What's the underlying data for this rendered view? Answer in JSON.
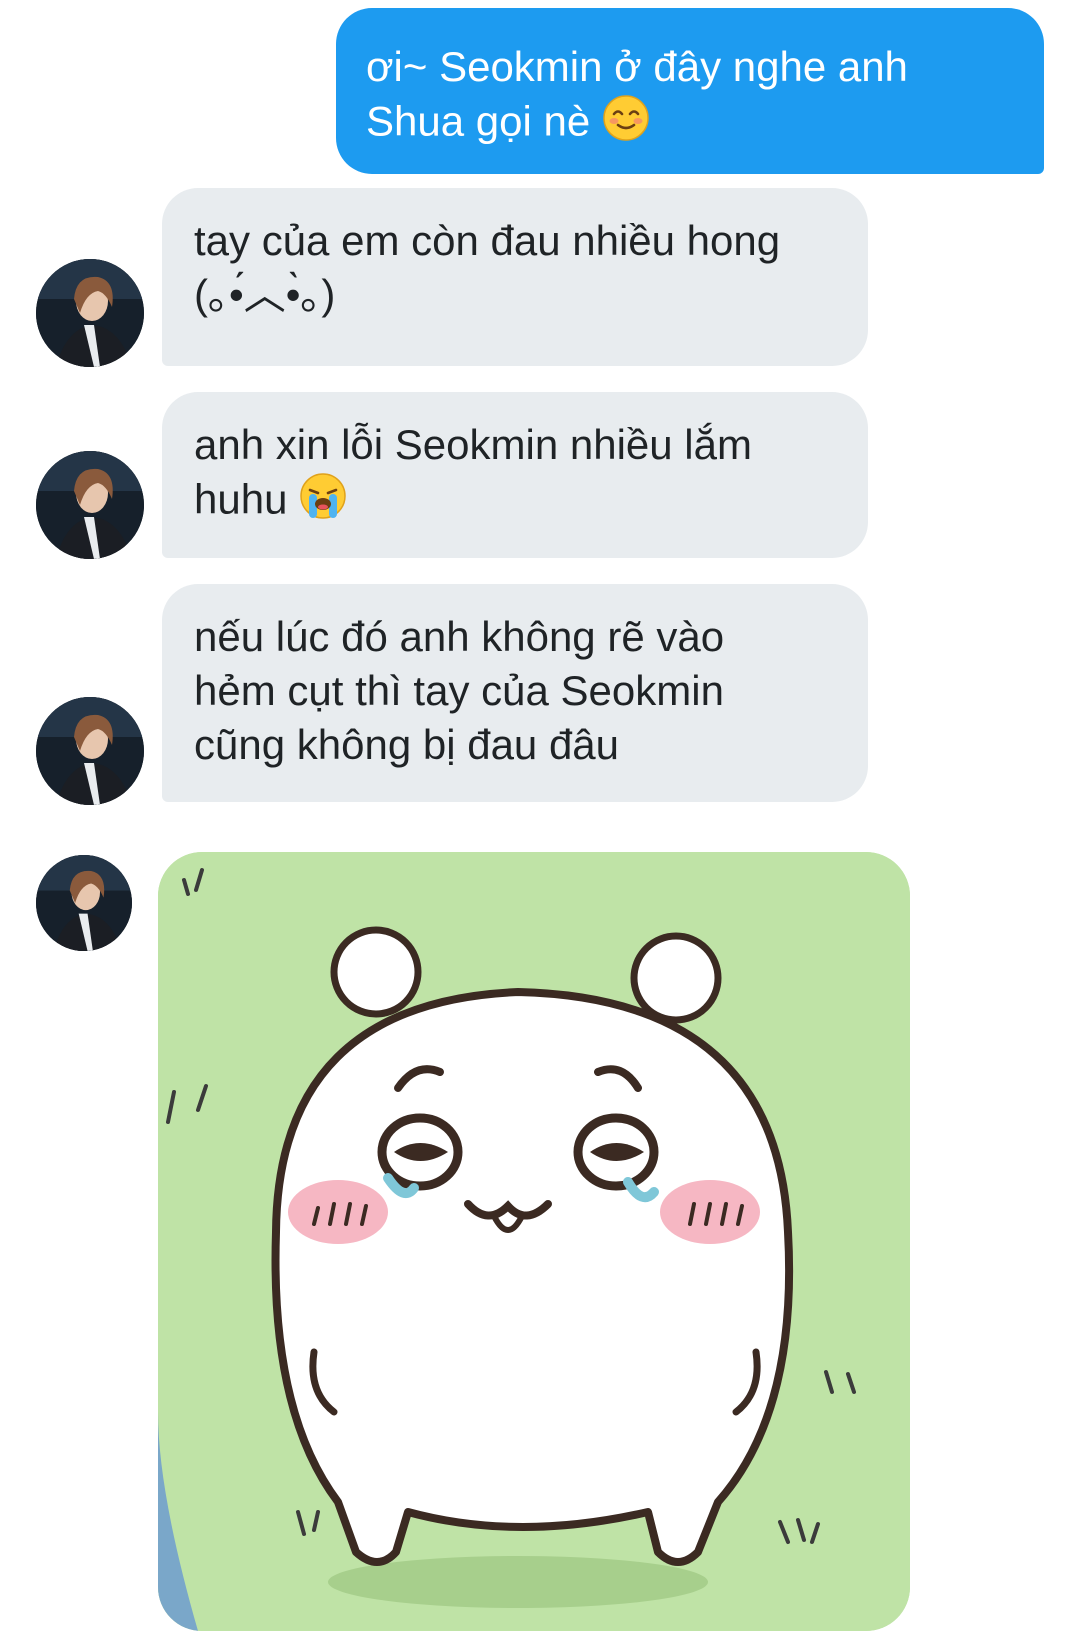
{
  "conversation": {
    "sent_messages": [
      {
        "line1": "ơi~ Seokmin ở đây nghe anh",
        "line2": "Shua gọi nè",
        "emoji": "smiling-face-with-smiling-eyes"
      }
    ],
    "received_messages": [
      {
        "line1": "tay của em còn đau nhiều hong",
        "line2": "(｡•́︿•̀｡)"
      },
      {
        "line1": "anh xin lỗi Seokmin nhiều lắm",
        "line2": "huhu",
        "emoji": "loudly-crying-face"
      },
      {
        "line1": "nếu lúc đó anh không rẽ vào",
        "line2": "hẻm cụt thì tay của Seokmin",
        "line3": "cũng không bị đau đâu"
      }
    ],
    "sticker": {
      "description_icon": "crying-bear-sticker"
    }
  },
  "colors": {
    "sent_bubble": "#1d9bf0",
    "received_bubble": "#e8ecef",
    "sticker_bg": "#bfe3a6"
  }
}
